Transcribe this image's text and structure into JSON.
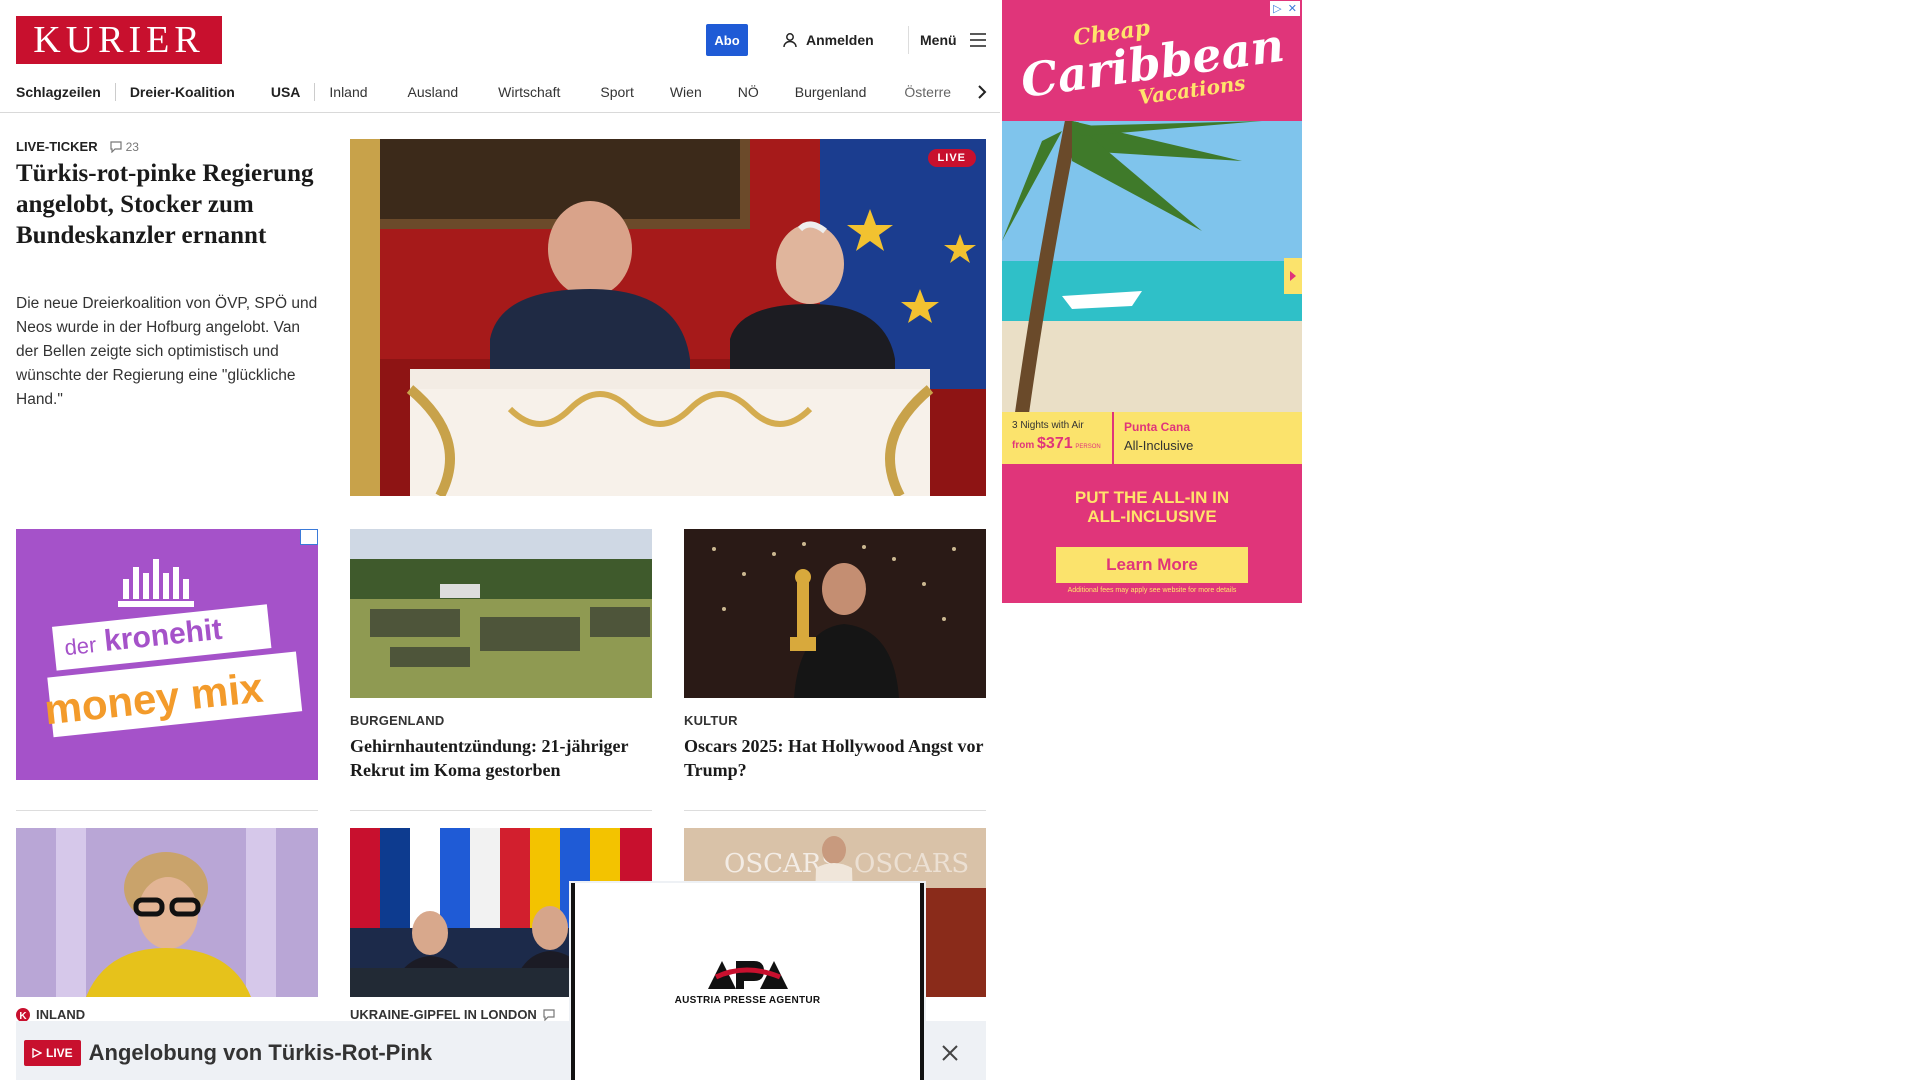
{
  "header": {
    "logo": "KURIER",
    "abo": "Abo",
    "login": "Anmelden",
    "menu": "Menü"
  },
  "nav": {
    "items": [
      "Schlagzeilen",
      "Dreier-Koalition",
      "USA",
      "Inland",
      "Ausland",
      "Wirtschaft",
      "Sport",
      "Wien",
      "NÖ",
      "Burgenland",
      "Österre"
    ]
  },
  "lead": {
    "kicker": "LIVE-TICKER",
    "comments": "23",
    "title": "Türkis-rot-pinke Regierung angelobt, Stocker zum Bundeskanzler ernannt",
    "text": "Die neue Dreierkoalition von ÖVP, SPÖ und Neos wurde in der Hofburg angelobt. Van der Bellen zeigte sich optimistisch und wünschte der Regierung eine \"glückliche Hand.\"",
    "live": "LIVE"
  },
  "ad_left": {
    "line1": "der",
    "line2": "kronehit",
    "line3": "money mix"
  },
  "cards": [
    {
      "kicker": "BURGENLAND",
      "title": "Gehirnhautentzündung: 21-jähriger Rekrut im Koma gestorben"
    },
    {
      "kicker": "KULTUR",
      "title": "Oscars 2025: Hat Hollywood Angst vor Trump?"
    }
  ],
  "bottom": [
    {
      "kicker": "INLAND"
    },
    {
      "kicker": "UKRAINE-GIPFEL IN LONDON"
    }
  ],
  "ad_right": {
    "cheap": "Cheap",
    "caribbean": "Caribbean",
    "vacations": "Vacations",
    "nights": "3 Nights with Air",
    "from": "from",
    "price": "$371",
    "per": "PERSON",
    "place": "Punta Cana",
    "allinc": "All-Inclusive",
    "slogan1": "PUT THE ALL-IN IN",
    "slogan2": "ALL-INCLUSIVE",
    "cta": "Learn More",
    "fine": "Additional fees may apply see website for more details"
  },
  "livebar": {
    "badge": "LIVE",
    "text": "Angelobung von Türkis-Rot-Pink"
  },
  "apa": {
    "logo": "APA",
    "sub": "AUSTRIA PRESSE AGENTUR"
  }
}
